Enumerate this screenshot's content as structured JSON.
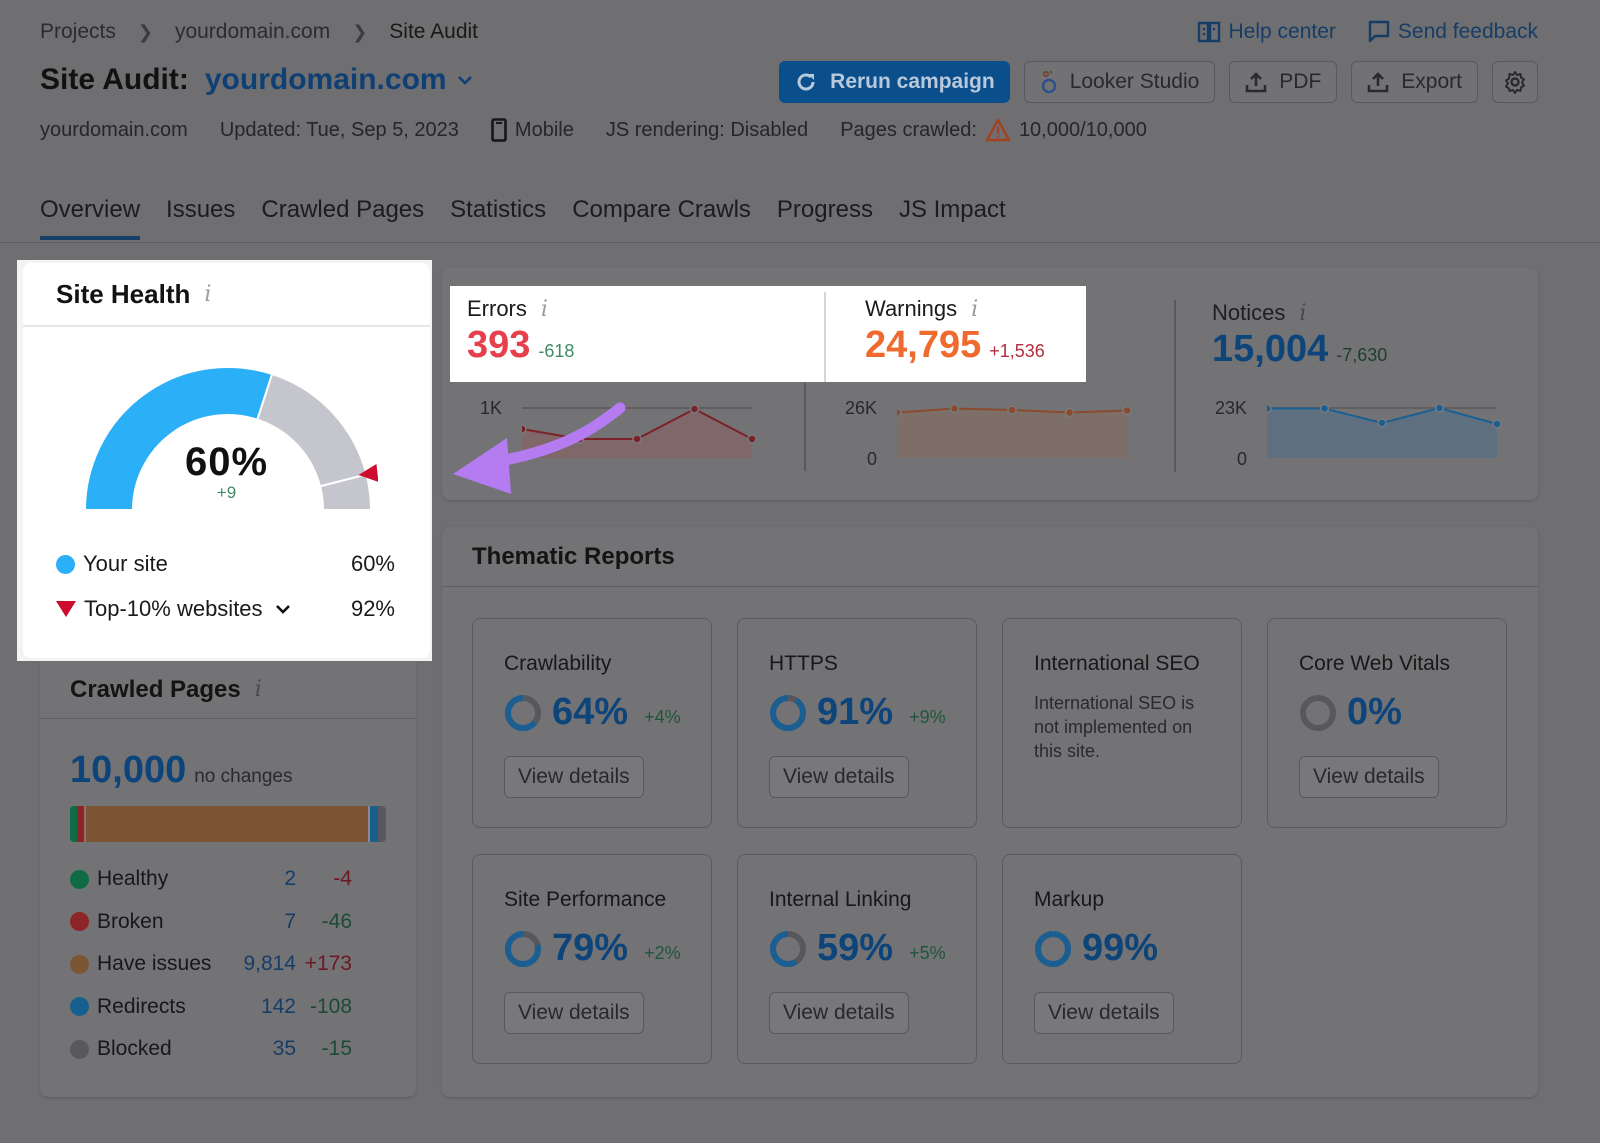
{
  "breadcrumb": [
    "Projects",
    "yourdomain.com",
    "Site Audit"
  ],
  "top_links": {
    "help": "Help center",
    "feedback": "Send feedback"
  },
  "header": {
    "title_prefix": "Site Audit:",
    "domain": "yourdomain.com"
  },
  "actions": {
    "rerun": "Rerun campaign",
    "looker": "Looker Studio",
    "pdf": "PDF",
    "export": "Export"
  },
  "meta": {
    "domain": "yourdomain.com",
    "updated": "Updated: Tue, Sep 5, 2023",
    "device": "Mobile",
    "js_rendering": "JS rendering: Disabled",
    "pages_crawled_label": "Pages crawled:",
    "pages_crawled_value": "10,000/10,000"
  },
  "tabs": [
    "Overview",
    "Issues",
    "Crawled Pages",
    "Statistics",
    "Compare Crawls",
    "Progress",
    "JS Impact"
  ],
  "site_health": {
    "title": "Site Health",
    "value": "60%",
    "value_fraction": 0.6,
    "top10_fraction": 0.92,
    "delta": "+9",
    "legend": [
      {
        "label": "Your site",
        "value": "60%"
      },
      {
        "label": "Top-10% websites",
        "value": "92%"
      }
    ],
    "colors": {
      "site": "#2bb0f8",
      "rest": "#c5c6cd",
      "marker": "#cc0d2e"
    }
  },
  "issues": {
    "errors": {
      "label": "Errors",
      "value": "393",
      "delta": "-618",
      "axis_top": "1K",
      "series": [
        0.58,
        0.38,
        0.38,
        0.98,
        0.38
      ],
      "color": "#e5404c"
    },
    "warnings": {
      "label": "Warnings",
      "value": "24,795",
      "delta": "+1,536",
      "axis_top": "26K",
      "axis_bottom": "0",
      "series": [
        0.91,
        0.99,
        0.96,
        0.91,
        0.95
      ],
      "color": "#ee6a2f"
    },
    "notices": {
      "label": "Notices",
      "value": "15,004",
      "delta": "-7,630",
      "axis_top": "23K",
      "axis_bottom": "0",
      "series": [
        0.99,
        0.99,
        0.7,
        1.0,
        0.68
      ],
      "color": "#0d4479"
    }
  },
  "crawled_pages": {
    "title": "Crawled Pages",
    "total": "10,000",
    "total_note": "no changes",
    "rows": [
      {
        "label": "Healthy",
        "value": "2",
        "change": "-4",
        "color": "#0e6b45",
        "change_color": "#6d1723"
      },
      {
        "label": "Broken",
        "value": "7",
        "change": "-46",
        "color": "#8e2328",
        "change_color": "#1d4a36"
      },
      {
        "label": "Have issues",
        "value": "9,814",
        "change": "+173",
        "color": "#7c5534",
        "change_color": "#6d1723"
      },
      {
        "label": "Redirects",
        "value": "142",
        "change": "-108",
        "color": "#175f8e",
        "change_color": "#1d4a36"
      },
      {
        "label": "Blocked",
        "value": "35",
        "change": "-15",
        "color": "#59595d",
        "change_color": "#1d4a36"
      }
    ]
  },
  "thematic": {
    "title": "Thematic Reports",
    "view_details": "View details",
    "cards": [
      {
        "name": "Crawlability",
        "score": "64%",
        "fraction": 0.64,
        "change": "+4%"
      },
      {
        "name": "HTTPS",
        "score": "91%",
        "fraction": 0.91,
        "change": "+9%"
      },
      {
        "name": "International SEO",
        "description": "International SEO is not implemented on this site."
      },
      {
        "name": "Core Web Vitals",
        "score": "0%",
        "fraction": 0,
        "change": ""
      },
      {
        "name": "Site Performance",
        "score": "79%",
        "fraction": 0.79,
        "change": "+2%"
      },
      {
        "name": "Internal Linking",
        "score": "59%",
        "fraction": 0.59,
        "change": "+5%"
      },
      {
        "name": "Markup",
        "score": "99%",
        "fraction": 0.99,
        "change": ""
      }
    ]
  },
  "annotation": {
    "arrow_color": "#b57cf2"
  }
}
